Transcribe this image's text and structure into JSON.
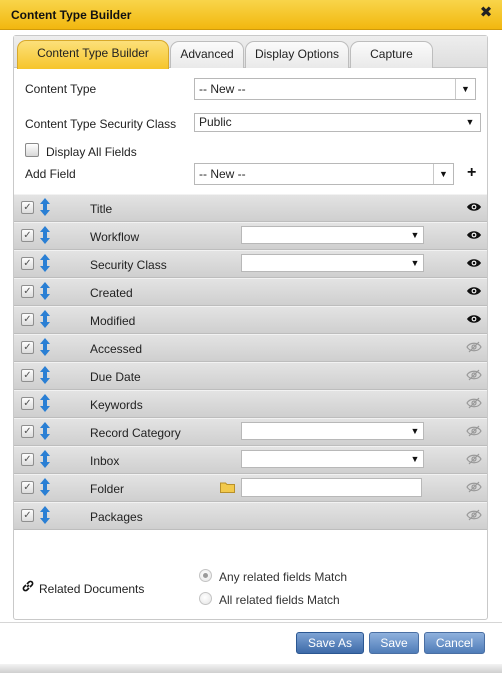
{
  "window": {
    "title": "Content Type Builder",
    "close_glyph": "✖"
  },
  "tabs": [
    {
      "label": "Content Type Builder",
      "active": true
    },
    {
      "label": "Advanced",
      "active": false
    },
    {
      "label": "Display Options",
      "active": false
    },
    {
      "label": "Capture",
      "active": false
    }
  ],
  "form": {
    "content_type_label": "Content Type",
    "content_type_value": "-- New --",
    "security_class_label": "Content Type Security Class",
    "security_class_value": "Public",
    "display_all_label": "Display All Fields",
    "display_all_checked": false,
    "add_field_label": "Add Field",
    "add_field_value": "-- New --",
    "add_glyph": "+"
  },
  "fields": [
    {
      "name": "Title",
      "visible": true,
      "control": "none"
    },
    {
      "name": "Workflow",
      "visible": true,
      "control": "select"
    },
    {
      "name": "Security Class",
      "visible": true,
      "control": "select"
    },
    {
      "name": "Created",
      "visible": true,
      "control": "none"
    },
    {
      "name": "Modified",
      "visible": true,
      "control": "none"
    },
    {
      "name": "Accessed",
      "visible": false,
      "control": "none"
    },
    {
      "name": "Due Date",
      "visible": false,
      "control": "none"
    },
    {
      "name": "Keywords",
      "visible": false,
      "control": "none"
    },
    {
      "name": "Record Category",
      "visible": false,
      "control": "select"
    },
    {
      "name": "Inbox",
      "visible": false,
      "control": "select"
    },
    {
      "name": "Folder",
      "visible": false,
      "control": "folder"
    },
    {
      "name": "Packages",
      "visible": false,
      "control": "none"
    }
  ],
  "related": {
    "label": "Related Documents",
    "options": [
      {
        "label": "Any related fields Match",
        "checked": true
      },
      {
        "label": "All related fields Match",
        "checked": false
      }
    ]
  },
  "buttons": {
    "save_as": "Save As",
    "save": "Save",
    "cancel": "Cancel"
  },
  "colors": {
    "title_bar": "#f2b70f",
    "active_tab": "#f6c52b",
    "button": "#4f7cb8",
    "move_arrow": "#2a7fd4"
  }
}
